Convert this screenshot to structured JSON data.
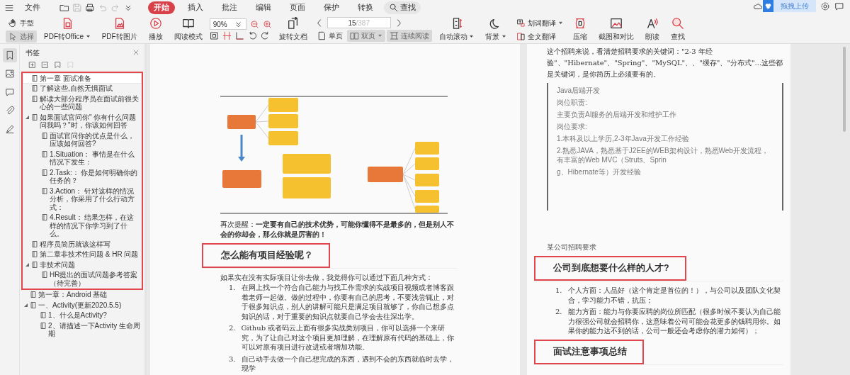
{
  "menubar": {
    "file": "文件",
    "quick_icons": [
      {
        "disabled": false
      },
      {
        "disabled": true
      },
      {
        "disabled": false
      },
      {
        "disabled": true
      },
      {
        "disabled": true
      },
      {
        "disabled": false
      }
    ],
    "tabs": [
      {
        "label": "开始",
        "selected": true
      },
      {
        "label": "插入",
        "selected": false
      },
      {
        "label": "批注",
        "selected": false
      },
      {
        "label": "编辑",
        "selected": false
      },
      {
        "label": "页面",
        "selected": false
      },
      {
        "label": "保护",
        "selected": false
      },
      {
        "label": "转换",
        "selected": false
      }
    ],
    "search": "查找",
    "upload_tip": "拖拽上传"
  },
  "ribbon": [
    {
      "kind": "pair",
      "items": [
        {
          "label": "手型",
          "selected": false
        },
        {
          "label": "选择",
          "selected": true
        }
      ]
    },
    {
      "kind": "big",
      "label": "PDF转Office",
      "dropdown": true
    },
    {
      "kind": "big",
      "label": "PDF转图片"
    },
    {
      "kind": "big",
      "label": "播放"
    },
    {
      "kind": "big",
      "label": "阅读模式"
    },
    {
      "kind": "zoom",
      "value": "90%"
    },
    {
      "kind": "big",
      "label": "旋转文档"
    },
    {
      "kind": "pager",
      "page": "15",
      "total": "/387",
      "modes": [
        {
          "label": "单页",
          "selected": false
        },
        {
          "label": "双页",
          "selected": true,
          "dropdown": true
        },
        {
          "label": "连续阅读",
          "selected": true
        }
      ]
    },
    {
      "kind": "big",
      "label": "自动滚动",
      "dropdown": true
    },
    {
      "kind": "big",
      "label": "背景",
      "dropdown": true
    },
    {
      "kind": "pair",
      "items": [
        {
          "label": "划词翻译",
          "selected": false,
          "dropdown": true
        },
        {
          "label": "全文翻译",
          "selected": false
        }
      ]
    },
    {
      "kind": "big",
      "label": "压缩"
    },
    {
      "kind": "big",
      "label": "截图和对比"
    },
    {
      "kind": "big",
      "label": "朗读"
    },
    {
      "kind": "big",
      "label": "查找"
    }
  ],
  "rail": [
    {
      "selected": true
    },
    {
      "selected": false
    },
    {
      "selected": false
    },
    {
      "selected": false
    },
    {
      "selected": false
    }
  ],
  "bookmarks": {
    "title": "书签",
    "tools": [
      {
        "disabled": false
      },
      {
        "disabled": false
      },
      {
        "disabled": false
      },
      {
        "disabled": true
      }
    ],
    "framed_items": [
      {
        "label": "第一章 面试准备",
        "selected": true
      },
      {
        "label": "了解这些,自然无惧面试",
        "selected": false
      },
      {
        "label": "解读大部分程序员在面试前很关心的一些问题",
        "selected": false
      },
      {
        "label": "如果面试官问你\" 你有什么问题问我吗？\"时，你该如何回答",
        "selected": false,
        "expanded": true,
        "children": [
          {
            "label": "面试官问你的优点是什么，应该如何回答?",
            "selected": false
          },
          {
            "label": "1.Situation： 事情是在什么情况下发生：",
            "selected": false
          },
          {
            "label": "2.Task:： 你是如何明确你的任务的？",
            "selected": false
          },
          {
            "label": "3.Action： 针对这样的情况分析，你采用了什么行动方式：",
            "selected": false
          },
          {
            "label": "4.Result： 结果怎样，在这样的情况下你学习到了什么。",
            "selected": false
          }
        ]
      },
      {
        "label": "程序员简历就该这样写",
        "selected": false
      },
      {
        "label": "第二章非技术性问题 & HR 问题",
        "selected": false
      },
      {
        "label": "非技术问题",
        "selected": false,
        "expanded": true,
        "children": [
          {
            "label": "HR提出的面试问题参考答案（待完善）",
            "selected": false
          }
        ]
      }
    ],
    "items": [
      {
        "label": "第一章：Android 基础",
        "selected": false
      },
      {
        "label": "一、Activity(更新2020.5.5)",
        "selected": false,
        "expanded": true,
        "children": [
          {
            "label": "1、什么是Activity?",
            "selected": false
          },
          {
            "label": "2、请描述一下Activity 生命周期",
            "selected": false
          }
        ]
      }
    ]
  },
  "pages": [
    {
      "blocks": [
        {
          "kind": "mindmap"
        },
        {
          "kind": "para",
          "text": "再次提醒：**一定要有自己的技术优势，可能你懂得不是最多的，但是别人不会的你却会，那么你就是厉害的！**"
        },
        {
          "kind": "heading",
          "text": "怎么能有项目经验呢？",
          "boxed": true
        },
        {
          "kind": "para",
          "text": "如果实在没有实际项目让你去做，我觉得你可以通过下面几种方式："
        },
        {
          "kind": "list",
          "items": [
            {
              "number": "1.",
              "text": "在网上找一个符合自己能力与找工作需求的实战项目视频或者博客跟着老师一起做。做的过程中，你要有自己的思考，不要浅尝辄止，对于很多知识点，别人的讲解可能只是满足项目就够了，你自己想多点知识的话，对于重要的知识点就要自己学会去往深出学。"
            },
            {
              "number": "2.",
              "text": "Github 或者码云上面有很多实战类别项目，你可以选择一个来研究，为了让自己对这个项目更加理解，在理解原有代码的基础上，你可以对原有项目进行改进或者增加功能。"
            },
            {
              "number": "3.",
              "text": "自己动手去做一个自己想完成的东西，遇到不会的东西就临时去学，现学"
            }
          ]
        }
      ]
    },
    {
      "blocks": [
        {
          "kind": "para",
          "text": "这个招聘来说，看清楚招聘要求的关键词：\"2-3 年经验\"、\"Hibernate\"、\"Spring\"、\"MySQL\"、、\"缓存\"、\"分布式\"...这些都是关键词，是你简历上必须要有的。"
        },
        {
          "kind": "posting",
          "lines": [
            "Java后端开发",
            "岗位职责:",
            "主要负责AI服务的后端开发和维护工作",
            "岗位要求:",
            "1.本科及以上学历,2-3年Java开发工作经验",
            "2.熟悉JAVA，熟悉基于J2EE的WEB架构设计，熟悉Web开发流程，有丰富的Web MVC（Struts、Sprin",
            "g、Hibernate等）开发经验"
          ]
        },
        {
          "kind": "caption",
          "text": "某公司招聘要求"
        },
        {
          "kind": "heading",
          "text": "公司到底想要什么样的人才?",
          "boxed": true
        },
        {
          "kind": "list",
          "items": [
            {
              "number": "1.",
              "text": "个人方面：人品好（这个肯定是首位的！），与公司以及团队文化契合，学习能力不错，抗压；"
            },
            {
              "number": "2.",
              "text": "能力方面：能力与你要应聘的岗位所匹配（很多时候不要认为自己能力很强公司就会招聘你，这意味着公司可能会花更多的钱聘用你。如果你的能力达不到的话，公司一般还会考虑你的潜力如何）；"
            }
          ]
        },
        {
          "kind": "heading",
          "text": "面试注意事项总结",
          "boxed": true
        }
      ]
    }
  ]
}
